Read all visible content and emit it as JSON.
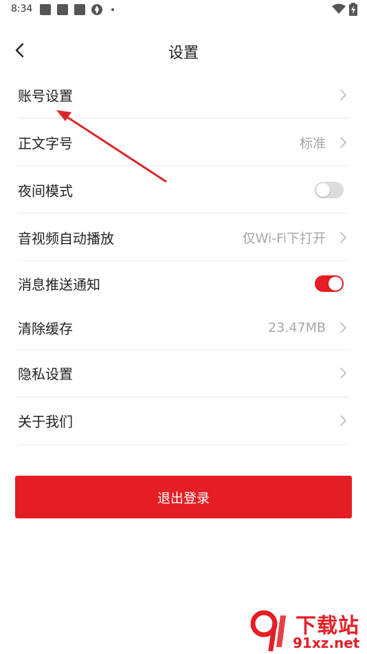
{
  "status_bar": {
    "time": "8:34"
  },
  "header": {
    "title": "设置",
    "back_icon": "chevron-left-icon"
  },
  "settings": {
    "account": {
      "label": "账号设置"
    },
    "font_size": {
      "label": "正文字号",
      "value": "标准"
    },
    "night_mode": {
      "label": "夜间模式",
      "enabled": false
    },
    "autoplay": {
      "label": "音视频自动播放",
      "value": "仅Wi-Fi下打开"
    },
    "push": {
      "label": "消息推送通知",
      "enabled": true
    },
    "cache": {
      "label": "清除缓存",
      "value": "23.47MB"
    },
    "privacy": {
      "label": "隐私设置"
    },
    "about": {
      "label": "关于我们"
    }
  },
  "logout_label": "退出登录",
  "watermark": {
    "title": "下载站",
    "url": "91xz.net"
  },
  "colors": {
    "accent": "#e41e24",
    "muted_text": "#a6a6a6",
    "divider": "#eeeeee"
  }
}
